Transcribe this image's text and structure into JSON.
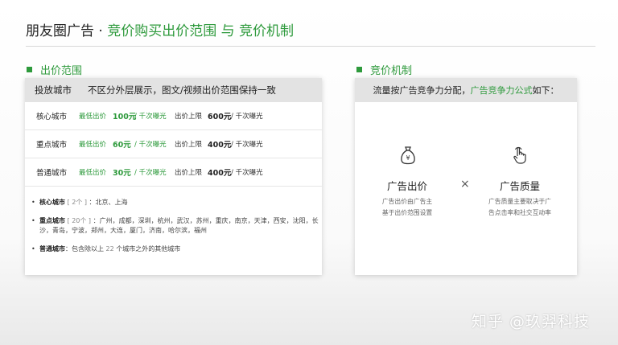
{
  "title": {
    "prefix": "朋友圈广告 · ",
    "highlight": "竞价购买出价范围 与 竞价机制"
  },
  "left": {
    "heading": "出价范围",
    "header": {
      "col1": "投放城市",
      "col2": "不区分外层展示，图文/视频出价范围保持一致"
    },
    "rows": [
      {
        "city": "核心城市",
        "min_label": "最低出价",
        "min_value": "100元",
        "min_unit": " / 千次曝光",
        "max_label": "出价上限",
        "max_value": "600元",
        "max_unit": " / 千次曝光"
      },
      {
        "city": "重点城市",
        "min_label": "最低出价",
        "min_value": "60元",
        "min_unit": " / 千次曝光",
        "max_label": "出价上限",
        "max_value": "400元",
        "max_unit": " / 千次曝光"
      },
      {
        "city": "普通城市",
        "min_label": "最低出价",
        "min_value": "30元",
        "min_unit": " / 千次曝光",
        "max_label": "出价上限",
        "max_value": "400元",
        "max_unit": " / 千次曝光"
      }
    ],
    "notes": [
      {
        "key": "核心城市",
        "count": " [ 2个 ] ",
        "text": "：北京、上海"
      },
      {
        "key": "重点城市",
        "count": " [ 20个 ] ",
        "text": "：广州，成都，深圳，杭州，武汉，苏州，重庆，南京，天津，西安，沈阳，长沙，青岛，宁波，郑州，大连，厦门，济南，哈尔滨，福州"
      },
      {
        "key": "普通城市",
        "prefix": "：包含除以上 ",
        "num": "22",
        "suffix": " 个城市之外的其他城市"
      }
    ]
  },
  "right": {
    "heading": "竞价机制",
    "header": {
      "pre": "流量按广告竞争力分配，",
      "green": "广告竞争力公式",
      "post": "如下："
    },
    "factor1": {
      "icon": "money-bag-icon",
      "title": "广告出价",
      "desc1": "广告出价由广告主",
      "desc2": "基于出价范围设置"
    },
    "operator": "×",
    "factor2": {
      "icon": "pointer-hand-icon",
      "title": "广告质量",
      "desc1": "广告质量主要取决于广",
      "desc2": "告点击率和社交互动率"
    }
  },
  "watermark": "知乎 @玖羿科技",
  "colors": {
    "accent": "#2e9a3c",
    "header_bg": "#e3e3e3"
  }
}
